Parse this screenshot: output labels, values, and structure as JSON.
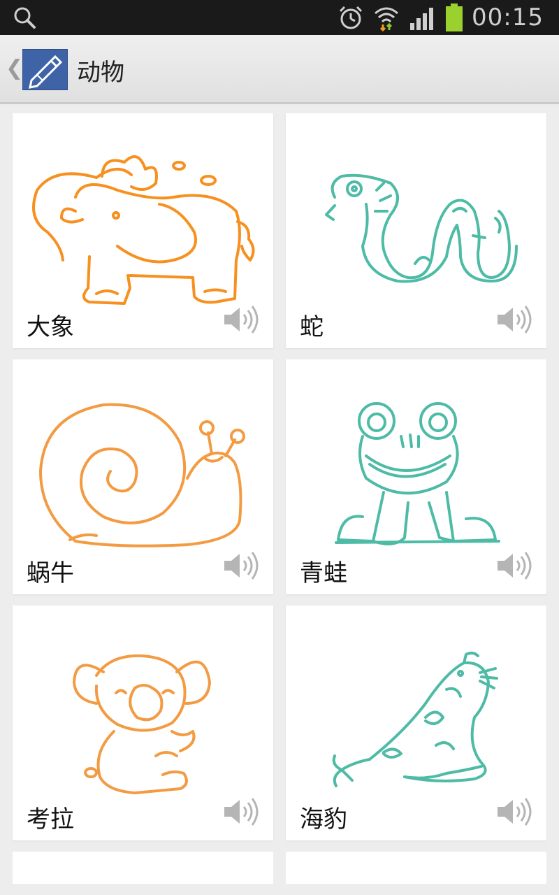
{
  "statusbar": {
    "time": "00:15"
  },
  "header": {
    "title": "动物"
  },
  "cards": [
    {
      "label": "大象",
      "color": "#f7901e",
      "art": "elephant-drawing"
    },
    {
      "label": "蛇",
      "color": "#4dbba5",
      "art": "snake-drawing"
    },
    {
      "label": "蜗牛",
      "color": "#f39b43",
      "art": "snail-drawing"
    },
    {
      "label": "青蛙",
      "color": "#4dbba5",
      "art": "frog-drawing"
    },
    {
      "label": "考拉",
      "color": "#f39b43",
      "art": "koala-drawing"
    },
    {
      "label": "海豹",
      "color": "#4dbba5",
      "art": "seal-drawing"
    }
  ]
}
